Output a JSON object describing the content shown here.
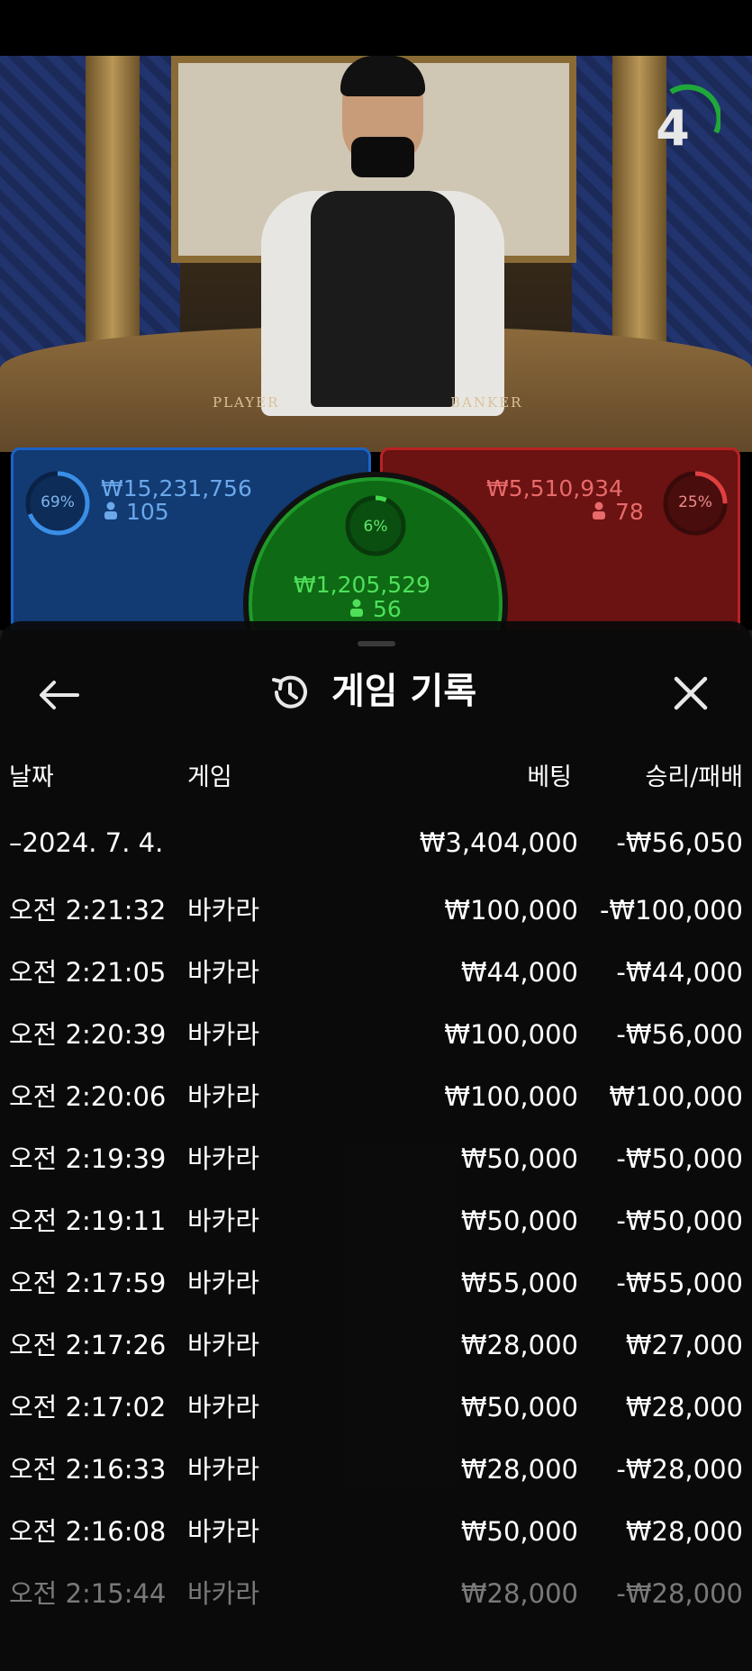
{
  "video": {
    "countdown": "4",
    "table_label_left": "PLAYER",
    "table_label_right": "BANKER"
  },
  "bets": {
    "player": {
      "amount": "₩15,231,756",
      "players": "105",
      "percent": "69%"
    },
    "banker": {
      "amount": "₩5,510,934",
      "players": "78",
      "percent": "25%"
    },
    "tie": {
      "amount": "₩1,205,529",
      "players": "56",
      "percent": "6%"
    }
  },
  "colors": {
    "player": "#1d62c7",
    "banker": "#b92222",
    "tie": "#1f9a2a"
  },
  "history": {
    "title": "게임 기록",
    "columns": {
      "date": "날짜",
      "game": "게임",
      "bet": "베팅",
      "result": "승리/패배"
    },
    "summary": {
      "date": "–2024. 7. 4.",
      "bet": "₩3,404,000",
      "result": "-₩56,050"
    },
    "rows": [
      {
        "time": "오전 2:21:32",
        "game": "바카라",
        "bet": "₩100,000",
        "result": "-₩100,000"
      },
      {
        "time": "오전 2:21:05",
        "game": "바카라",
        "bet": "₩44,000",
        "result": "-₩44,000"
      },
      {
        "time": "오전 2:20:39",
        "game": "바카라",
        "bet": "₩100,000",
        "result": "-₩56,000"
      },
      {
        "time": "오전 2:20:06",
        "game": "바카라",
        "bet": "₩100,000",
        "result": "₩100,000"
      },
      {
        "time": "오전 2:19:39",
        "game": "바카라",
        "bet": "₩50,000",
        "result": "-₩50,000"
      },
      {
        "time": "오전 2:19:11",
        "game": "바카라",
        "bet": "₩50,000",
        "result": "-₩50,000"
      },
      {
        "time": "오전 2:17:59",
        "game": "바카라",
        "bet": "₩55,000",
        "result": "-₩55,000"
      },
      {
        "time": "오전 2:17:26",
        "game": "바카라",
        "bet": "₩28,000",
        "result": "₩27,000"
      },
      {
        "time": "오전 2:17:02",
        "game": "바카라",
        "bet": "₩50,000",
        "result": "₩28,000"
      },
      {
        "time": "오전 2:16:33",
        "game": "바카라",
        "bet": "₩28,000",
        "result": "-₩28,000"
      },
      {
        "time": "오전 2:16:08",
        "game": "바카라",
        "bet": "₩50,000",
        "result": "₩28,000"
      },
      {
        "time": "오전 2:15:44",
        "game": "바카라",
        "bet": "₩28,000",
        "result": "-₩28,000"
      }
    ]
  },
  "icons": {
    "back": "arrow-left-icon",
    "history": "history-icon",
    "close": "close-icon",
    "person": "person-icon"
  }
}
